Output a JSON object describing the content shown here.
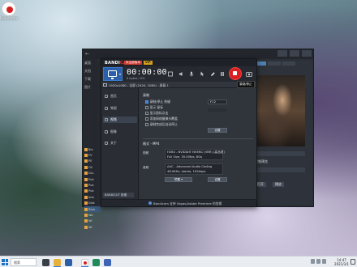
{
  "desktop": {
    "icon_label": "Bandicam"
  },
  "explorer": {
    "nav": [
      "桌面",
      "文档",
      "下载",
      "图片"
    ],
    "files": [
      "Bin",
      "FV",
      "PE",
      "OC",
      "DLL",
      "Pub",
      "Pub",
      "Pub",
      "Inte",
      "Disk",
      "Riva",
      "Wa",
      "Wi",
      "Wi"
    ],
    "right_caption": "视频预览",
    "right_field": "...",
    "right_btn1": "打开",
    "right_btn2": "播放"
  },
  "bandicam": {
    "logo_main": "BANDI",
    "logo_accent": "CAM",
    "badge_trial": "未注册版本",
    "badge_vip": "VIP",
    "timer": "00:00:00",
    "size": "0 bytes / 0%",
    "tooltip": "录制/停止",
    "modebar_text": "1920x1080 - 全屏 (1920, 1080) - 屏幕 1",
    "sidebar": [
      {
        "label": "首页",
        "active": false
      },
      {
        "label": "常规",
        "active": false
      },
      {
        "label": "视频",
        "active": true
      },
      {
        "label": "图像",
        "active": false
      },
      {
        "label": "关于",
        "active": false
      }
    ],
    "sidebar_footer": "BANDICUT 剪辑",
    "section_record": "录制",
    "checks": [
      {
        "label": "录制/停止 热键",
        "checked": true
      },
      {
        "label": "显示 鼠标",
        "checked": false
      },
      {
        "label": "显示鼠标点击",
        "checked": false
      },
      {
        "label": "添加网络摄像头覆盖",
        "checked": false
      },
      {
        "label": "录制完成后自动停止",
        "checked": false
      }
    ],
    "hotkey": "F12",
    "settings_btn": "设置",
    "section_format": "格式 - MP4",
    "video_label": "视频",
    "video_line1": "H264 - NVIDIA® NVENC (VBR) (高品质)",
    "video_line2": "Full Size, 30.00fps, 80q",
    "audio_label": "音频",
    "audio_line1": "AAC - Advanced Audio Coding",
    "audio_line2": "48.0KHz, stereo, 192kbps",
    "preset_btn": "预置",
    "settings_btn2": "设置",
    "status": "Bandicam 支持 Vegas/Adobe Premiere 的剪辑"
  },
  "taskbar": {
    "search_placeholder": "搜索",
    "time": "14:47",
    "date": "2021/3/1"
  },
  "colors": {
    "accent_blue": "#2b5fa8",
    "record_red": "#d91f1f",
    "window_bg": "#2d3138"
  }
}
